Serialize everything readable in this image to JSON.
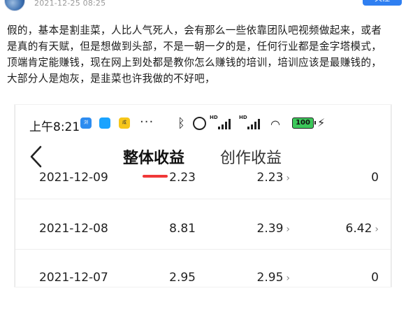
{
  "post": {
    "date": "2021-12-25 08:25",
    "follow_label": "关注",
    "lines": [
      "假的，基本是割韭菜，人比人气死人，会有那么一些依靠团队吧视频做起来，或者",
      "是真的有天赋，但是想做到头部，不是一朝一夕的是，任何行业都是金字塔模式，",
      "顶端肯定能赚钱，现在网上到处都是教你怎么赚钱的培训，培训应该是最赚钱的，",
      "大部分人是炮灰，是韭菜也许我做的不好吧，"
    ]
  },
  "phone": {
    "status": {
      "time": "上午8:21",
      "app1": "浏",
      "app2": "",
      "app3": "咸",
      "dots": "···",
      "battery": "100"
    },
    "tabs": [
      "整体收益",
      "创作收益"
    ],
    "rows": [
      {
        "date": "2021-12-09",
        "c1": "2.23",
        "c2": "2.23",
        "c3": "0"
      },
      {
        "date": "2021-12-08",
        "c1": "8.81",
        "c2": "2.39",
        "c3": "6.42"
      },
      {
        "date": "2021-12-07",
        "c1": "2.95",
        "c2": "2.95",
        "c3": "0"
      }
    ]
  },
  "icons": {
    "back": "chevron-left-icon",
    "bluetooth": "bluetooth-icon",
    "alarm": "alarm-icon",
    "wifi": "wifi-icon",
    "charging": "charging-icon"
  },
  "colors": {
    "accent": "#2f7ff1",
    "tab_underline": "#f03838",
    "battery": "#3cc85a"
  }
}
